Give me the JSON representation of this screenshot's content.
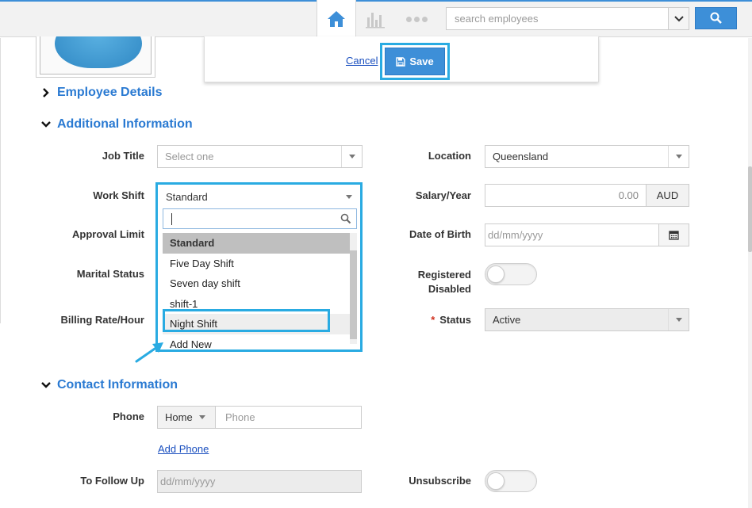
{
  "topbar": {
    "search_placeholder": "search employees"
  },
  "actions": {
    "cancel_label": "Cancel",
    "save_label": "Save"
  },
  "sections": {
    "employee_details": "Employee Details",
    "additional_information": "Additional Information",
    "contact_information": "Contact Information"
  },
  "fields": {
    "job_title": {
      "label": "Job Title",
      "placeholder": "Select one"
    },
    "work_shift": {
      "label": "Work Shift",
      "value": "Standard"
    },
    "approval_limit": {
      "label": "Approval Limit"
    },
    "marital_status": {
      "label": "Marital Status"
    },
    "billing_rate": {
      "label": "Billing Rate/Hour"
    },
    "location": {
      "label": "Location",
      "value": "Queensland"
    },
    "salary": {
      "label": "Salary/Year",
      "value": "0.00",
      "currency": "AUD"
    },
    "dob": {
      "label": "Date of Birth",
      "placeholder": "dd/mm/yyyy"
    },
    "registered_disabled": {
      "label_line1": "Registered",
      "label_line2": "Disabled"
    },
    "status": {
      "label": "Status",
      "required_mark": "*",
      "value": "Active"
    },
    "phone": {
      "label": "Phone",
      "type_value": "Home",
      "placeholder": "Phone",
      "add_label": "Add Phone"
    },
    "to_follow_up": {
      "label": "To Follow Up",
      "placeholder": "dd/mm/yyyy"
    },
    "unsubscribe": {
      "label": "Unsubscribe"
    }
  },
  "work_shift_dropdown": {
    "options": [
      "Standard",
      "Five Day Shift",
      "Seven day shift",
      "shift-1",
      "Night Shift",
      "Add New"
    ],
    "selected": "Standard",
    "highlighted": "Night Shift"
  },
  "colors": {
    "accent": "#3d8fd8",
    "heading": "#2a7ad2",
    "callout": "#29abe2",
    "link": "#1a4fbf"
  }
}
